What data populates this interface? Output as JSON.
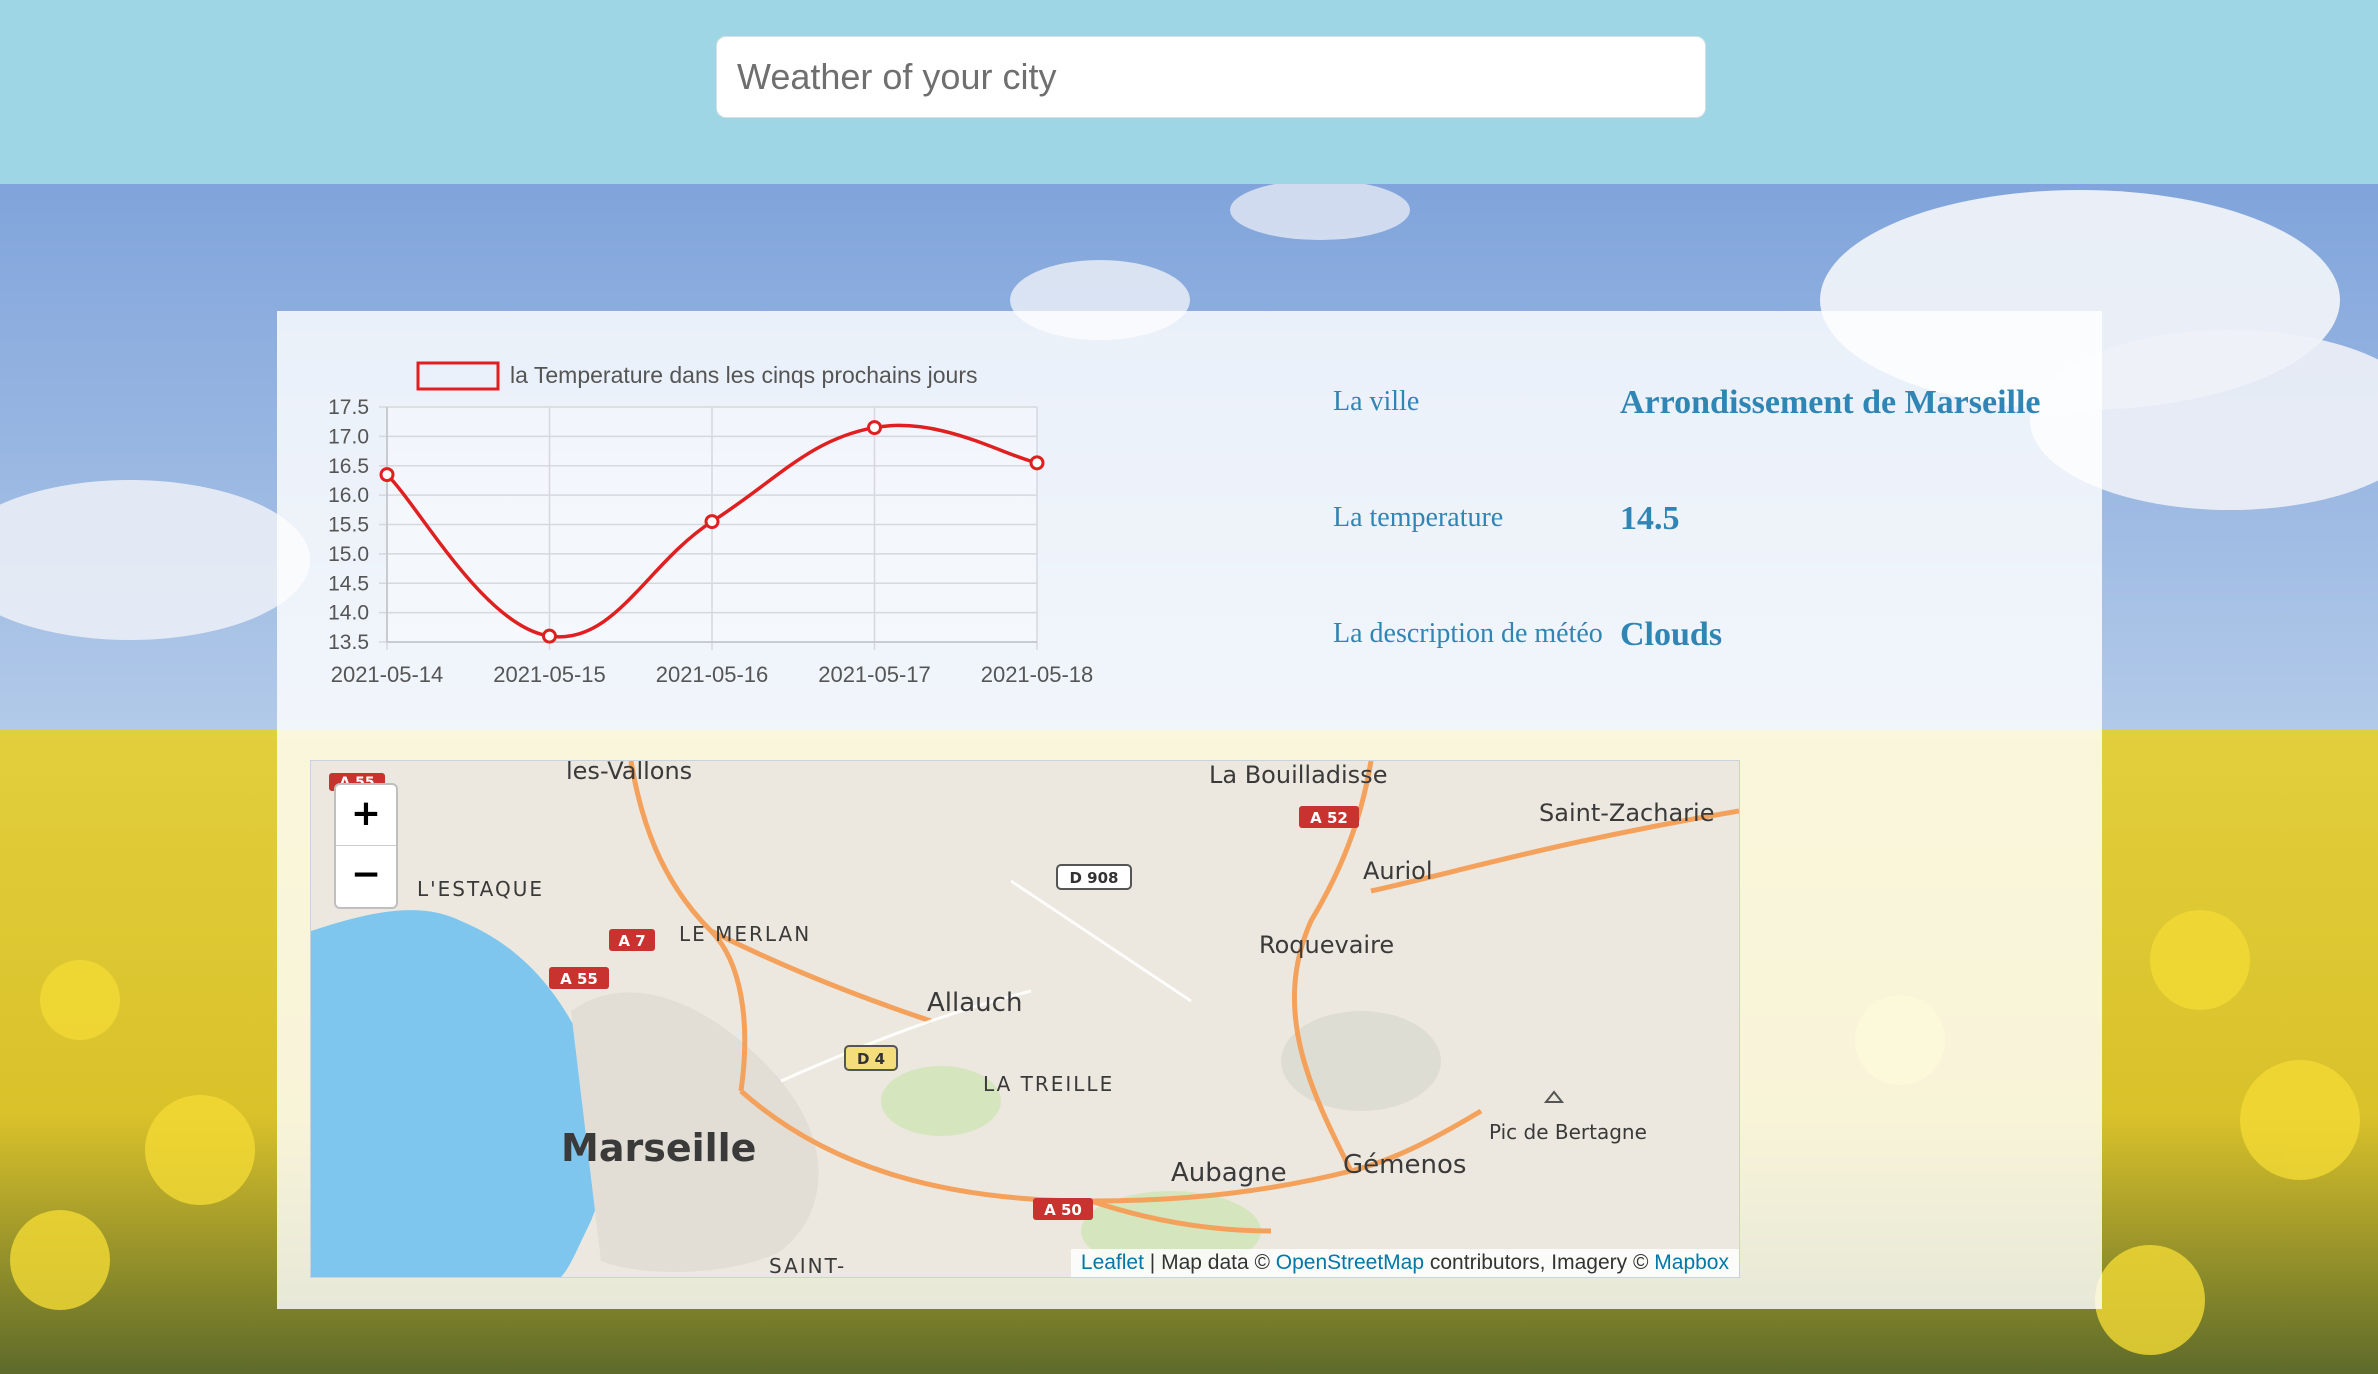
{
  "search": {
    "placeholder": "Weather of your city"
  },
  "info": {
    "city_label": "La ville",
    "city_value": "Arrondissement de Marseille",
    "temp_label": "La temperature",
    "temp_value": "14.5",
    "desc_label": "La description de météo",
    "desc_value": "Clouds"
  },
  "chart_data": {
    "type": "line",
    "categories": [
      "2021-05-14",
      "2021-05-15",
      "2021-05-16",
      "2021-05-17",
      "2021-05-18"
    ],
    "series": [
      {
        "name": "la Temperature dans les cinqs prochains jours",
        "values": [
          16.35,
          13.6,
          15.55,
          17.15,
          16.55
        ],
        "color": "#e02020"
      }
    ],
    "yticks": [
      "17.5",
      "17.0",
      "16.5",
      "16.0",
      "15.5",
      "15.0",
      "14.5",
      "14.0",
      "13.5"
    ],
    "ylim": [
      13.5,
      17.5
    ],
    "grid": true,
    "legend": "top"
  },
  "map": {
    "zoom_in": "+",
    "zoom_out": "−",
    "places": {
      "marseille": "Marseille",
      "aubagne": "Aubagne",
      "allauch": "Allauch",
      "roquevaire": "Roquevaire",
      "auriol": "Auriol",
      "gemenos": "Gémenos",
      "la_bouilladisse": "La Bouilladisse",
      "saint_zacharie": "Saint-Zacharie",
      "les_vallons": "les-Vallons",
      "lestaque": "L'ESTAQUE",
      "le_merlan": "LE MERLAN",
      "la_treille": "LA TREILLE",
      "pic_de_bertagne": "Pic de Bertagne",
      "saint": "SAINT-"
    },
    "roads": {
      "a55": "A 55",
      "a55_top": "A 55",
      "a7": "A 7",
      "a52": "A 52",
      "a50": "A 50",
      "d908": "D 908",
      "d4": "D 4"
    },
    "attribution": {
      "leaflet": "Leaflet",
      "sep": " | Map data © ",
      "osm": "OpenStreetMap",
      "mid": " contributors, Imagery © ",
      "mapbox": "Mapbox"
    }
  }
}
